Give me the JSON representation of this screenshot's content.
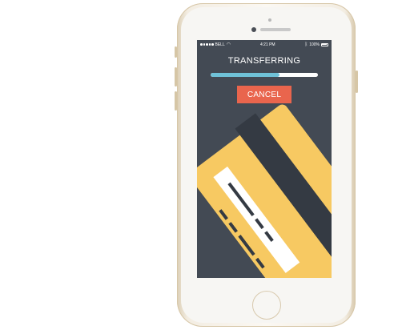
{
  "status_bar": {
    "carrier": "BELL",
    "time": "4:21 PM",
    "battery": "100%"
  },
  "transfer": {
    "title": "TRANSFERRING",
    "progress": 0.64,
    "cancel_label": "CANCEL"
  },
  "colors": {
    "screen_bg": "#434a54",
    "progress_fill": "#6fc2d8",
    "cancel_button": "#e9654d",
    "card_yellow": "#f7c962",
    "card_stripe": "#343a43"
  },
  "icons": [
    "signal-icon",
    "wifi-icon",
    "bluetooth-icon",
    "battery-icon",
    "credit-card-icon"
  ]
}
